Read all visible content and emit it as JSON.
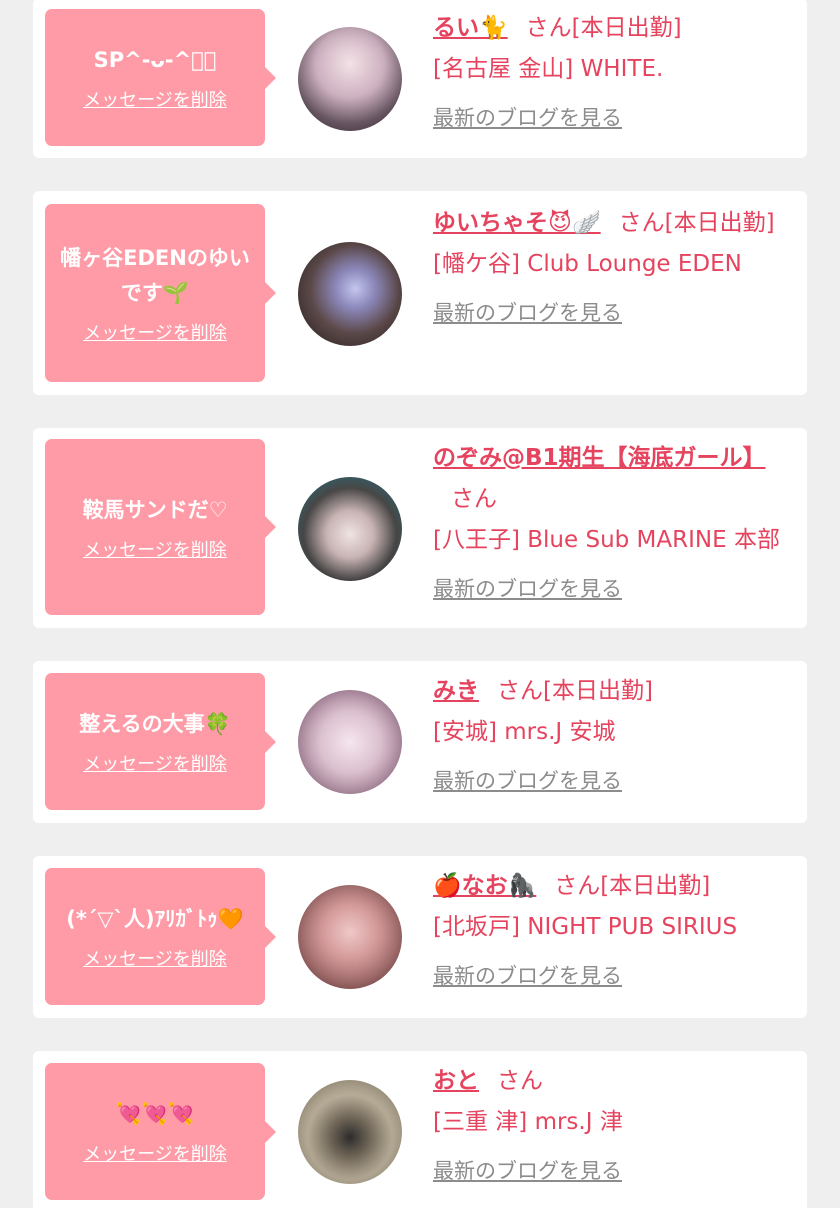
{
  "entries": [
    {
      "message": "SP^-ᴗ-^ฅ゙",
      "delete_label": "メッセージを削除",
      "name": "るい🐈",
      "suffix": "さん[本日出勤]",
      "shop": "[名古屋 金山] WHITE.",
      "blog_label": "最新のブログを見る"
    },
    {
      "message": "幡ヶ谷EDENのゆいです🌱",
      "delete_label": "メッセージを削除",
      "name": "ゆいちゃそ😈🪽",
      "suffix": "さん[本日出勤]",
      "shop": "[幡ケ谷] Club Lounge EDEN",
      "blog_label": "最新のブログを見る"
    },
    {
      "message": "鞍馬サンドだ♡",
      "delete_label": "メッセージを削除",
      "name": "のぞみ@B1期生【海底ガール】",
      "suffix": "さん",
      "shop": "[八王子] Blue Sub MARINE 本部",
      "blog_label": "最新のブログを見る"
    },
    {
      "message": "整えるの大事🍀",
      "delete_label": "メッセージを削除",
      "name": "みき",
      "suffix": "さん[本日出勤]",
      "shop": "[安城] mrs.J 安城",
      "blog_label": "最新のブログを見る"
    },
    {
      "message": "(*´▽`人)ｱﾘｶﾞﾄｩ🧡",
      "delete_label": "メッセージを削除",
      "name": "🍎なお🦍",
      "suffix": "さん[本日出勤]",
      "shop": "[北坂戸] NIGHT PUB SIRIUS",
      "blog_label": "最新のブログを見る"
    },
    {
      "message": "💘💘💘",
      "delete_label": "メッセージを削除",
      "name": "おと",
      "suffix": "さん",
      "shop": "[三重 津] mrs.J 津",
      "blog_label": "最新のブログを見る"
    }
  ],
  "colors": {
    "accent": "#e5435e",
    "bubble": "#ff9ba6",
    "background": "#efefef",
    "link_gray": "#8c8c8c"
  }
}
